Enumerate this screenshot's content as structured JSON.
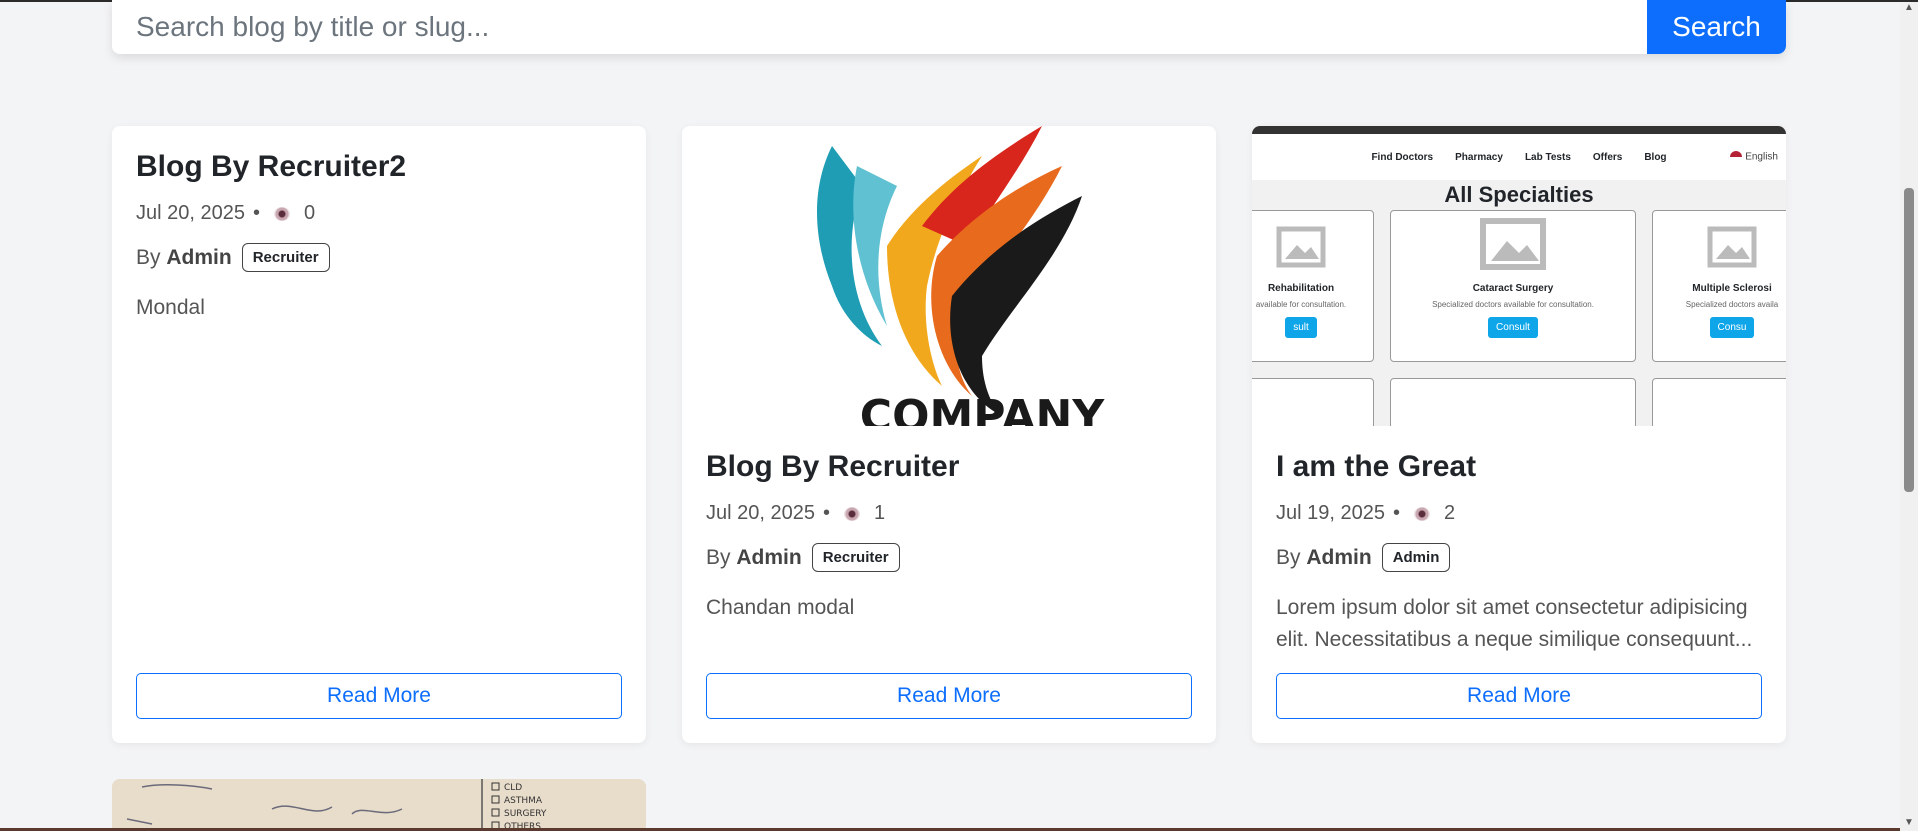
{
  "search": {
    "placeholder": "Search blog by title or slug...",
    "button_label": "Search"
  },
  "cards": [
    {
      "title": "Blog By Recruiter2",
      "date": "Jul 20, 2025",
      "views": "0",
      "by": "By",
      "author": "Admin",
      "role": "Recruiter",
      "excerpt": "Mondal",
      "read_more": "Read More"
    },
    {
      "title": "Blog By Recruiter",
      "date": "Jul 20, 2025",
      "views": "1",
      "by": "By",
      "author": "Admin",
      "role": "Recruiter",
      "excerpt": "Chandan modal",
      "read_more": "Read More",
      "image_text": "COMPANY"
    },
    {
      "title": "I am the Great",
      "date": "Jul 19, 2025",
      "views": "2",
      "by": "By",
      "author": "Admin",
      "role": "Admin",
      "excerpt": "Lorem ipsum dolor sit amet consectetur adipisicing elit. Necessitatibus a neque similique consequunt...",
      "read_more": "Read More",
      "screenshot": {
        "nav": [
          "Find Doctors",
          "Pharmacy",
          "Lab Tests",
          "Offers",
          "Blog"
        ],
        "language": "English",
        "heading": "All Specialties",
        "tiles": [
          {
            "name": "Rehabilitation",
            "desc": "available for consultation.",
            "btn": "sult"
          },
          {
            "name": "Cataract Surgery",
            "desc": "Specialized doctors available for consultation.",
            "btn": "Consult"
          },
          {
            "name": "Multiple Sclerosi",
            "desc": "Specialized doctors availa",
            "btn": "Consu"
          }
        ]
      }
    }
  ],
  "bottom_card_image": {
    "labels": [
      "CLD",
      "ASTHMA",
      "SURGERY",
      "OTHERS"
    ]
  }
}
